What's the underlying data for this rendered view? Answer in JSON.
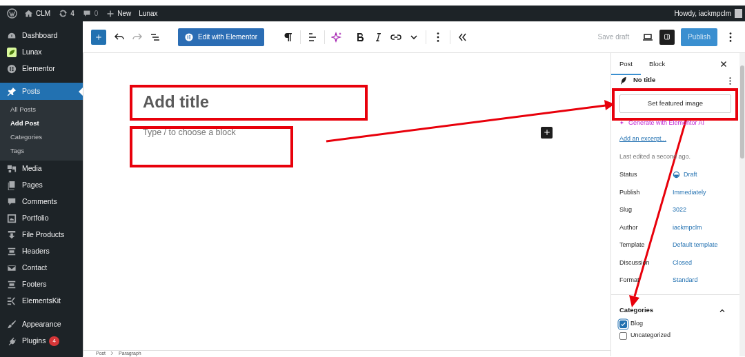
{
  "admin_bar": {
    "site": "CLM",
    "updates": "4",
    "comments": "0",
    "new": "New",
    "theme": "Lunax",
    "greeting": "Howdy, iackmpclm"
  },
  "sidebar": {
    "items": [
      {
        "label": "Dashboard",
        "selected": false
      },
      {
        "label": "Lunax",
        "selected": false
      },
      {
        "label": "Elementor",
        "selected": false
      },
      {
        "label": "Posts",
        "selected": true,
        "children": [
          {
            "label": "All Posts",
            "selected": false
          },
          {
            "label": "Add Post",
            "selected": true
          },
          {
            "label": "Categories",
            "selected": false
          },
          {
            "label": "Tags",
            "selected": false
          }
        ]
      },
      {
        "label": "Media",
        "selected": false
      },
      {
        "label": "Pages",
        "selected": false
      },
      {
        "label": "Comments",
        "selected": false
      },
      {
        "label": "Portfolio",
        "selected": false
      },
      {
        "label": "File Products",
        "selected": false
      },
      {
        "label": "Headers",
        "selected": false
      },
      {
        "label": "Contact",
        "selected": false
      },
      {
        "label": "Footers",
        "selected": false
      },
      {
        "label": "ElementsKit",
        "selected": false
      },
      {
        "label": "Appearance",
        "selected": false
      },
      {
        "label": "Plugins",
        "selected": false,
        "badge": "4"
      }
    ]
  },
  "toolbar": {
    "elementor_button": "Edit with Elementor",
    "save_draft": "Save draft",
    "settings_pressed": true,
    "publish": "Publish"
  },
  "editor": {
    "title_placeholder": "Add title",
    "block_placeholder": "Type / to choose a block"
  },
  "panel": {
    "tabs": [
      {
        "label": "Post",
        "selected": true
      },
      {
        "label": "Block",
        "selected": false
      }
    ],
    "post_title": "No title",
    "featured_image_button": "Set featured image",
    "ai_link": "Generate with Elementor AI",
    "excerpt_link": "Add an excerpt...",
    "last_edited": "Last edited a second ago.",
    "fields": [
      {
        "label": "Status",
        "value": "Draft",
        "kind": "status"
      },
      {
        "label": "Publish",
        "value": "Immediately",
        "kind": "link"
      },
      {
        "label": "Slug",
        "value": "3022",
        "kind": "link"
      },
      {
        "label": "Author",
        "value": "iackmpclm",
        "kind": "link"
      },
      {
        "label": "Template",
        "value": "Default template",
        "kind": "link"
      },
      {
        "label": "Discussion",
        "value": "Closed",
        "kind": "link"
      },
      {
        "label": "Format",
        "value": "Standard",
        "kind": "link"
      }
    ],
    "categories": {
      "title": "Categories",
      "expanded": true,
      "items": [
        {
          "label": "Blog",
          "checked": true
        },
        {
          "label": "Uncategorized",
          "checked": false
        }
      ]
    }
  },
  "breadcrumb": [
    "Post",
    "Paragraph"
  ]
}
